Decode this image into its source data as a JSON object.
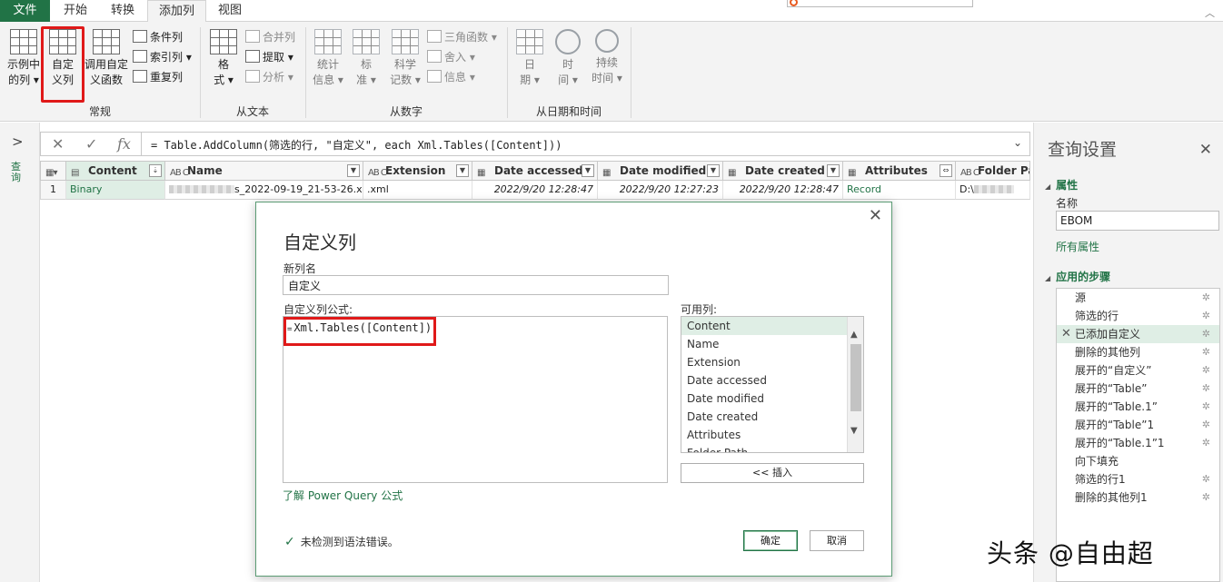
{
  "tabs": [
    {
      "label": "文件"
    },
    {
      "label": "开始"
    },
    {
      "label": "转换"
    },
    {
      "label": "添加列"
    },
    {
      "label": "视图"
    }
  ],
  "ribbon": {
    "general": {
      "group_label": "常规",
      "example_col": [
        "示例中",
        "的列"
      ],
      "custom_col": [
        "自定",
        "义列"
      ],
      "invoke_fn": [
        "调用自定",
        "义函数"
      ],
      "conditional_col": "条件列",
      "index_col": "索引列",
      "duplicate_col": "重复列"
    },
    "from_text": {
      "group_label": "从文本",
      "format": [
        "格",
        "式"
      ],
      "merge_cols": "合并列",
      "extract": "提取",
      "parse": "分析"
    },
    "from_number": {
      "group_label": "从数字",
      "statistics": [
        "统计",
        "信息"
      ],
      "standard": [
        "标",
        "准"
      ],
      "scientific": [
        "科学",
        "记数"
      ],
      "trig": "三角函数",
      "rounding": "舍入",
      "information": "信息"
    },
    "from_datetime": {
      "group_label": "从日期和时间",
      "date": [
        "日",
        "期"
      ],
      "time": [
        "时",
        "间"
      ],
      "duration": [
        "持续",
        "时间"
      ]
    }
  },
  "left_pane": {
    "label": "查询"
  },
  "formula_bar": {
    "text": "= Table.AddColumn(筛选的行, \"自定义\", each Xml.Tables([Content]))"
  },
  "table": {
    "headers": [
      {
        "label": "Content",
        "type_icon": "▤"
      },
      {
        "label": "Name",
        "type_icon": "AB C"
      },
      {
        "label": "Extension",
        "type_icon": "AB C"
      },
      {
        "label": "Date accessed",
        "type_icon": "▦"
      },
      {
        "label": "Date modified",
        "type_icon": "▦"
      },
      {
        "label": "Date created",
        "type_icon": "▦"
      },
      {
        "label": "Attributes",
        "type_icon": "▦"
      },
      {
        "label": "Folder Path",
        "type_icon": "AB C"
      }
    ],
    "row": {
      "index": "1",
      "content": "Binary",
      "name": "s_2022-09-19_21-53-26.x...",
      "extension": ".xml",
      "date_accessed": "2022/9/20 12:28:47",
      "date_modified": "2022/9/20 12:27:23",
      "date_created": "2022/9/20 12:28:47",
      "attributes": "Record",
      "folder_path": "D:\\"
    }
  },
  "dialog": {
    "title": "自定义列",
    "new_col_label": "新列名",
    "new_col_value": "自定义",
    "formula_label": "自定义列公式:",
    "formula_prefix": "=",
    "formula_text": "Xml.Tables([Content])",
    "available_label": "可用列:",
    "available_columns": [
      "Content",
      "Name",
      "Extension",
      "Date accessed",
      "Date modified",
      "Date created",
      "Attributes",
      "Folder Path"
    ],
    "insert_button": "<< 插入",
    "learn_link": "了解 Power Query 公式",
    "status": "未检测到语法错误。",
    "ok_button": "确定",
    "cancel_button": "取消"
  },
  "query_settings": {
    "title": "查询设置",
    "properties_label": "属性",
    "name_label": "名称",
    "name_value": "EBOM",
    "all_properties_link": "所有属性",
    "applied_steps_label": "应用的步骤",
    "steps": [
      {
        "label": "源"
      },
      {
        "label": "筛选的行"
      },
      {
        "label": "已添加自定义"
      },
      {
        "label": "删除的其他列"
      },
      {
        "label": "展开的“自定义”"
      },
      {
        "label": "展开的“Table”"
      },
      {
        "label": "展开的“Table.1”"
      },
      {
        "label": "展开的“Table”1"
      },
      {
        "label": "展开的“Table.1”1"
      },
      {
        "label": "向下填充"
      },
      {
        "label": "筛选的行1"
      },
      {
        "label": "删除的其他列1"
      }
    ]
  },
  "watermark": "头条 @自由超",
  "colors": {
    "accent": "#217346",
    "highlight": "#e01919",
    "selection": "#dfeee5"
  }
}
